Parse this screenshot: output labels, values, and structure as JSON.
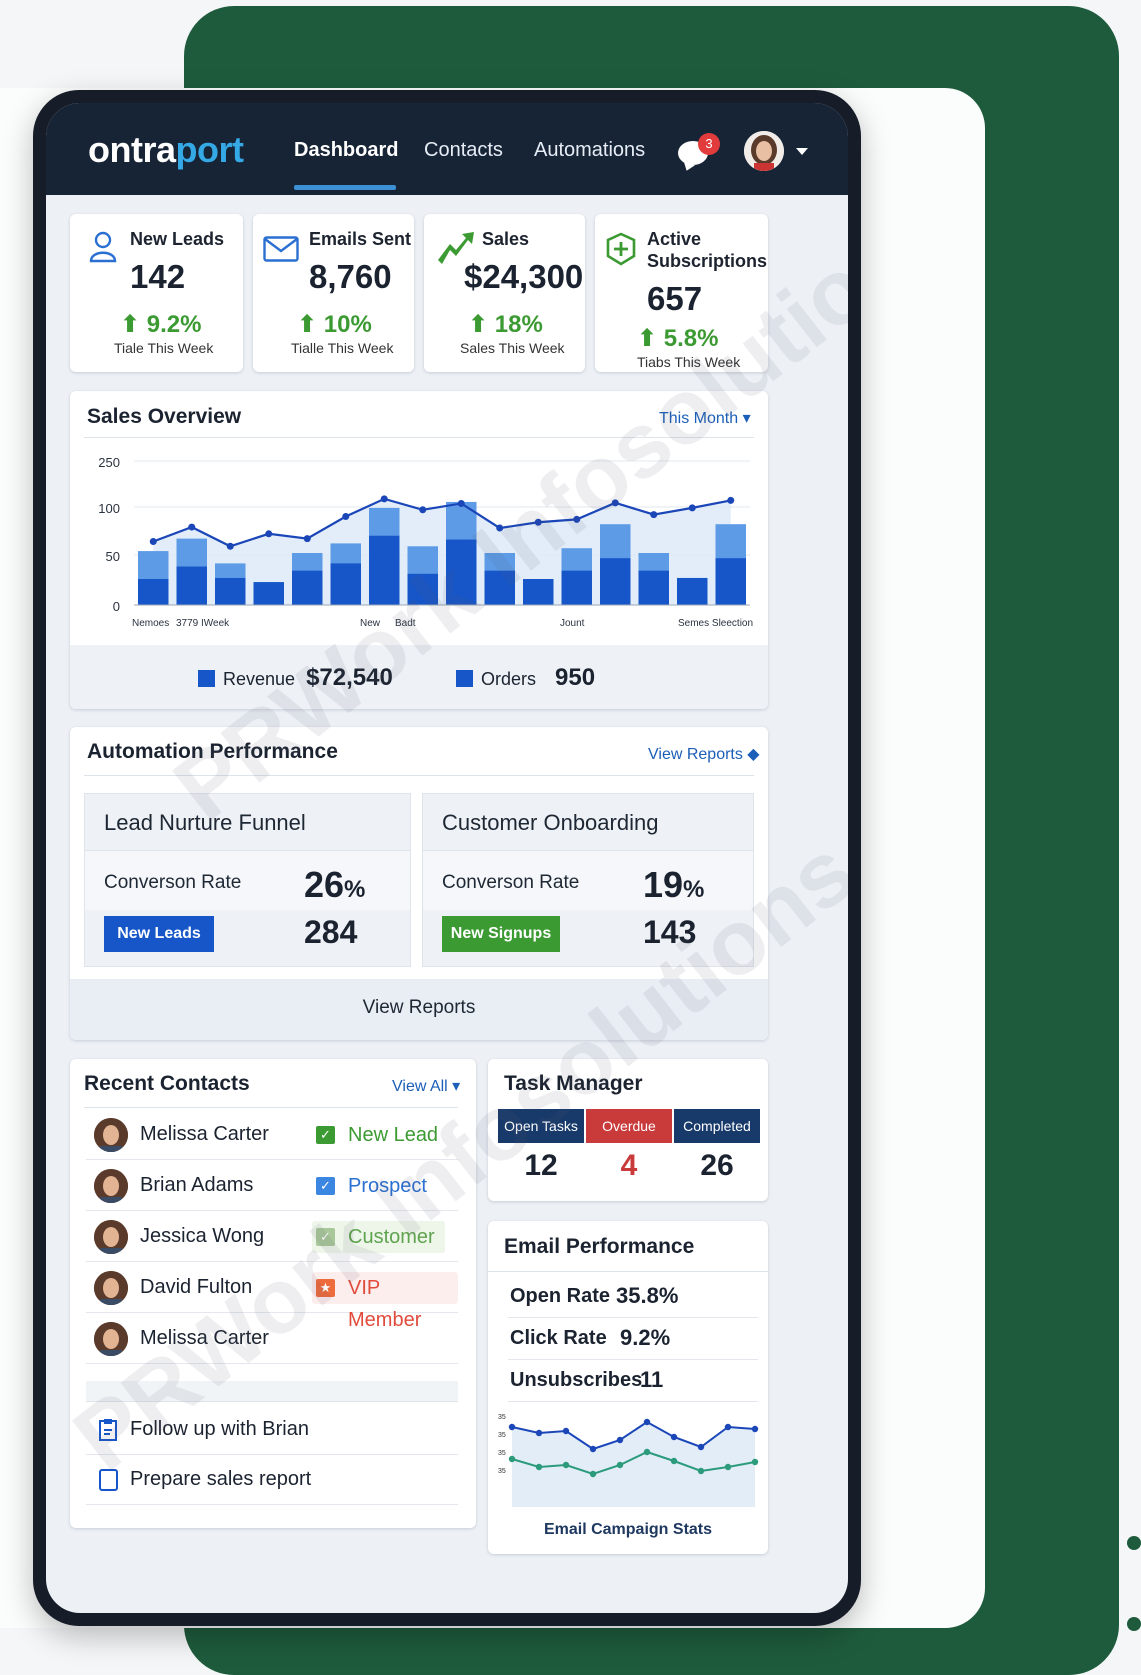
{
  "app": {
    "logo_left": "ontra",
    "logo_right": "port",
    "nav": [
      "Dashboard",
      "Contacts",
      "Automations"
    ],
    "notification_count": "3"
  },
  "stats": [
    {
      "title": "New Leads",
      "value": "142",
      "change": "9.2%",
      "sub": "Tiale This Week",
      "icon": "user-icon"
    },
    {
      "title": "Emails Sent",
      "value": "8,760",
      "change": "10%",
      "sub": "Tialle This Week",
      "icon": "envelope-icon"
    },
    {
      "title": "Sales",
      "value": "$24,300",
      "change": "18%",
      "sub": "Sales This Week",
      "icon": "trend-arrow-icon"
    },
    {
      "title_line1": "Active",
      "title_line2": "Subscriptions",
      "value": "657",
      "change": "5.8%",
      "sub": "Tiabs This Week",
      "icon": "plus-badge-icon"
    }
  ],
  "sales_overview": {
    "title": "Sales Overview",
    "period": "This Month",
    "y_ticks": [
      "250",
      "100",
      "50",
      "0"
    ],
    "x_labels": [
      "Nemoes",
      "3779 IWeek",
      "New",
      "Badt",
      "Jount",
      "Semes Sleection"
    ],
    "revenue_label": "Revenue",
    "revenue_value": "$72,540",
    "orders_label": "Orders",
    "orders_value": "950"
  },
  "chart_data": {
    "type": "bar",
    "title": "Sales Overview",
    "y_ticks": [
      250,
      100,
      50,
      0
    ],
    "series": [
      {
        "name": "Revenue",
        "values": [
          25,
          37,
          26,
          22,
          33,
          40,
          68,
          30,
          64,
          33,
          25,
          33,
          45,
          33,
          26,
          45
        ]
      },
      {
        "name": "Orders",
        "values": [
          52,
          65,
          40,
          22,
          50,
          60,
          97,
          57,
          110,
          50,
          25,
          55,
          80,
          50,
          26,
          80
        ]
      },
      {
        "name": "Trend",
        "type": "line",
        "values": [
          62,
          77,
          57,
          70,
          65,
          88,
          120,
          95,
          105,
          76,
          82,
          85,
          107,
          90,
          97,
          115
        ]
      }
    ],
    "colors": {
      "revenue": "#1656c8",
      "orders": "#5d9be6",
      "trend": "#1a46b8",
      "area": "#dce9f8"
    }
  },
  "automation": {
    "title": "Automation Performance",
    "link": "View Reports",
    "footer": "View Reports",
    "funnels": [
      {
        "title": "Lead Nurture Funnel",
        "rate_label": "Converson Rate",
        "rate": "26",
        "btn": "New Leads",
        "count": "284"
      },
      {
        "title": "Customer Onboarding",
        "rate_label": "Converson Rate",
        "rate": "19",
        "btn": "New Signups",
        "count": "143"
      }
    ],
    "pct_sign": "%"
  },
  "contacts": {
    "title": "Recent Contacts",
    "link": "View All",
    "rows": [
      {
        "name": "Melissa Carter",
        "tag": "New Lead"
      },
      {
        "name": "Brian Adams",
        "tag": "Prospect"
      },
      {
        "name": "Jessica Wong",
        "tag": "Customer"
      },
      {
        "name": "David Fulton",
        "tag": "VIP Member"
      },
      {
        "name": "Melissa Carter",
        "tag": ""
      }
    ],
    "todos": [
      "Follow up with Brian",
      "Prepare sales report"
    ]
  },
  "tasks": {
    "title": "Task Manager",
    "cols": [
      {
        "label": "Open Tasks",
        "value": "12"
      },
      {
        "label": "Overdue",
        "value": "4"
      },
      {
        "label": "Completed",
        "value": "26"
      }
    ]
  },
  "email": {
    "title": "Email Performance",
    "rows": [
      {
        "label": "Open Rate",
        "value": "35.8%"
      },
      {
        "label": "Click Rate",
        "value": "9.2%"
      },
      {
        "label": "Unsubscribes",
        "value": "11"
      }
    ],
    "chart_caption": "Email Campaign Stats",
    "y_ticks": [
      "35",
      "35",
      "35",
      "35"
    ]
  },
  "watermark": "PRWork Infosolutions"
}
